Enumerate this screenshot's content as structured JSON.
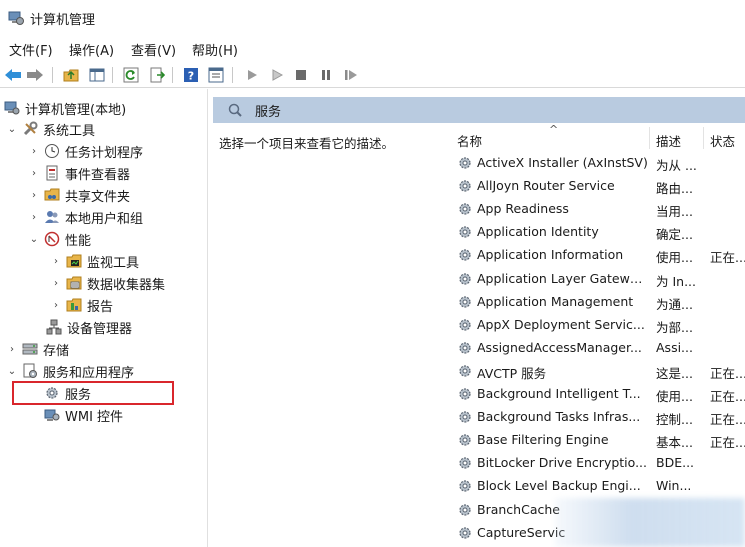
{
  "window": {
    "title": "计算机管理"
  },
  "menu": {
    "file": "文件(F)",
    "action": "操作(A)",
    "view": "查看(V)",
    "help": "帮助(H)"
  },
  "toolbar": {
    "buttons": [
      "back-arrow-icon",
      "forward-arrow-icon",
      "folder-up-icon",
      "show-hide-tree-icon",
      "refresh-icon",
      "export-list-icon",
      "help-icon",
      "properties-icon",
      "play-icon",
      "play-outline-icon",
      "stop-icon",
      "pause-icon",
      "restart-icon"
    ]
  },
  "tree": {
    "root": "计算机管理(本地)",
    "system_tools": "系统工具",
    "task_scheduler": "任务计划程序",
    "event_viewer": "事件查看器",
    "shared_folders": "共享文件夹",
    "local_users": "本地用户和组",
    "performance": "性能",
    "monitor_tools": "监视工具",
    "data_collector": "数据收集器集",
    "reports": "报告",
    "device_manager": "设备管理器",
    "storage": "存储",
    "services_apps": "服务和应用程序",
    "services": "服务",
    "wmi": "WMI 控件"
  },
  "panel": {
    "header": "服务",
    "description": "选择一个项目来查看它的描述。"
  },
  "columns": {
    "name": "名称",
    "sort_caret": "^",
    "description": "描述",
    "status": "状态"
  },
  "services": [
    {
      "name": "ActiveX Installer (AxInstSV)",
      "desc": "为从 ...",
      "status": ""
    },
    {
      "name": "AllJoyn Router Service",
      "desc": "路由...",
      "status": ""
    },
    {
      "name": "App Readiness",
      "desc": "当用...",
      "status": ""
    },
    {
      "name": "Application Identity",
      "desc": "确定...",
      "status": ""
    },
    {
      "name": "Application Information",
      "desc": "使用...",
      "status": "正在..."
    },
    {
      "name": "Application Layer Gatewa...",
      "desc": "为 In...",
      "status": ""
    },
    {
      "name": "Application Management",
      "desc": "为通...",
      "status": ""
    },
    {
      "name": "AppX Deployment Servic...",
      "desc": "为部...",
      "status": ""
    },
    {
      "name": "AssignedAccessManager...",
      "desc": "Assi...",
      "status": ""
    },
    {
      "name": "AVCTP 服务",
      "desc": "这是...",
      "status": "正在..."
    },
    {
      "name": "Background Intelligent T...",
      "desc": "使用...",
      "status": "正在..."
    },
    {
      "name": "Background Tasks Infras...",
      "desc": "控制...",
      "status": "正在..."
    },
    {
      "name": "Base Filtering Engine",
      "desc": "基本...",
      "status": "正在..."
    },
    {
      "name": "BitLocker Drive Encryptio...",
      "desc": "BDE...",
      "status": ""
    },
    {
      "name": "Block Level Backup Engi...",
      "desc": "Win...",
      "status": ""
    },
    {
      "name": "BranchCache",
      "desc": "",
      "status": ""
    },
    {
      "name": "CaptureServic",
      "desc": "",
      "status": ""
    }
  ],
  "colors": {
    "header_bg": "#b9cbe0",
    "highlight": "#d9262c"
  }
}
